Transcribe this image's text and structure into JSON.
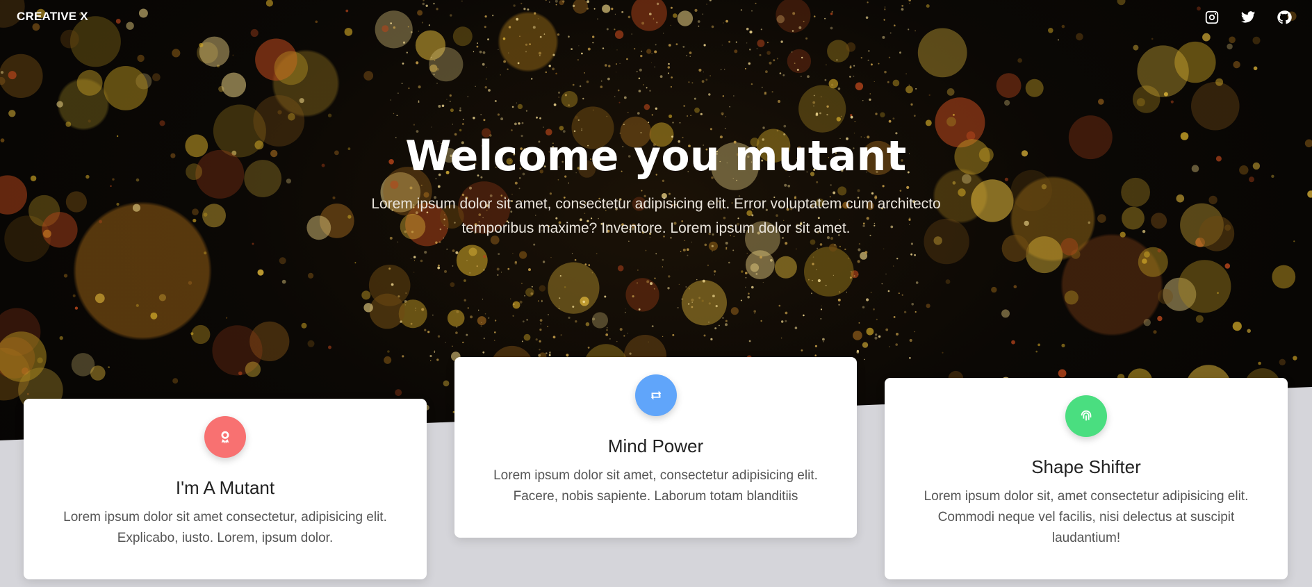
{
  "nav": {
    "brand": "CREATIVE X",
    "social": [
      {
        "name": "instagram-icon"
      },
      {
        "name": "twitter-icon"
      },
      {
        "name": "github-icon"
      }
    ]
  },
  "hero": {
    "title": "Welcome you mutant",
    "text": "Lorem ipsum dolor sit amet, consectetur adipisicing elit. Error voluptatem cum architecto temporibus maxime? Inventore. Lorem ipsum dolor sit amet."
  },
  "cards": [
    {
      "title": "I'm A Mutant",
      "text": "Lorem ipsum dolor sit amet consectetur, adipisicing elit. Explicabo, iusto. Lorem, ipsum dolor.",
      "icon": "award-icon",
      "color": "#f87171"
    },
    {
      "title": "Mind Power",
      "text": "Lorem ipsum dolor sit amet, consectetur adipisicing elit. Facere, nobis sapiente. Laborum totam blanditiis",
      "icon": "repeat-icon",
      "color": "#60a5fa"
    },
    {
      "title": "Shape Shifter",
      "text": "Lorem ipsum dolor sit, amet consectetur adipisicing elit. Commodi neque vel facilis, nisi delectus at suscipit laudantium!",
      "icon": "fingerprint-icon",
      "color": "#4ade80"
    }
  ]
}
